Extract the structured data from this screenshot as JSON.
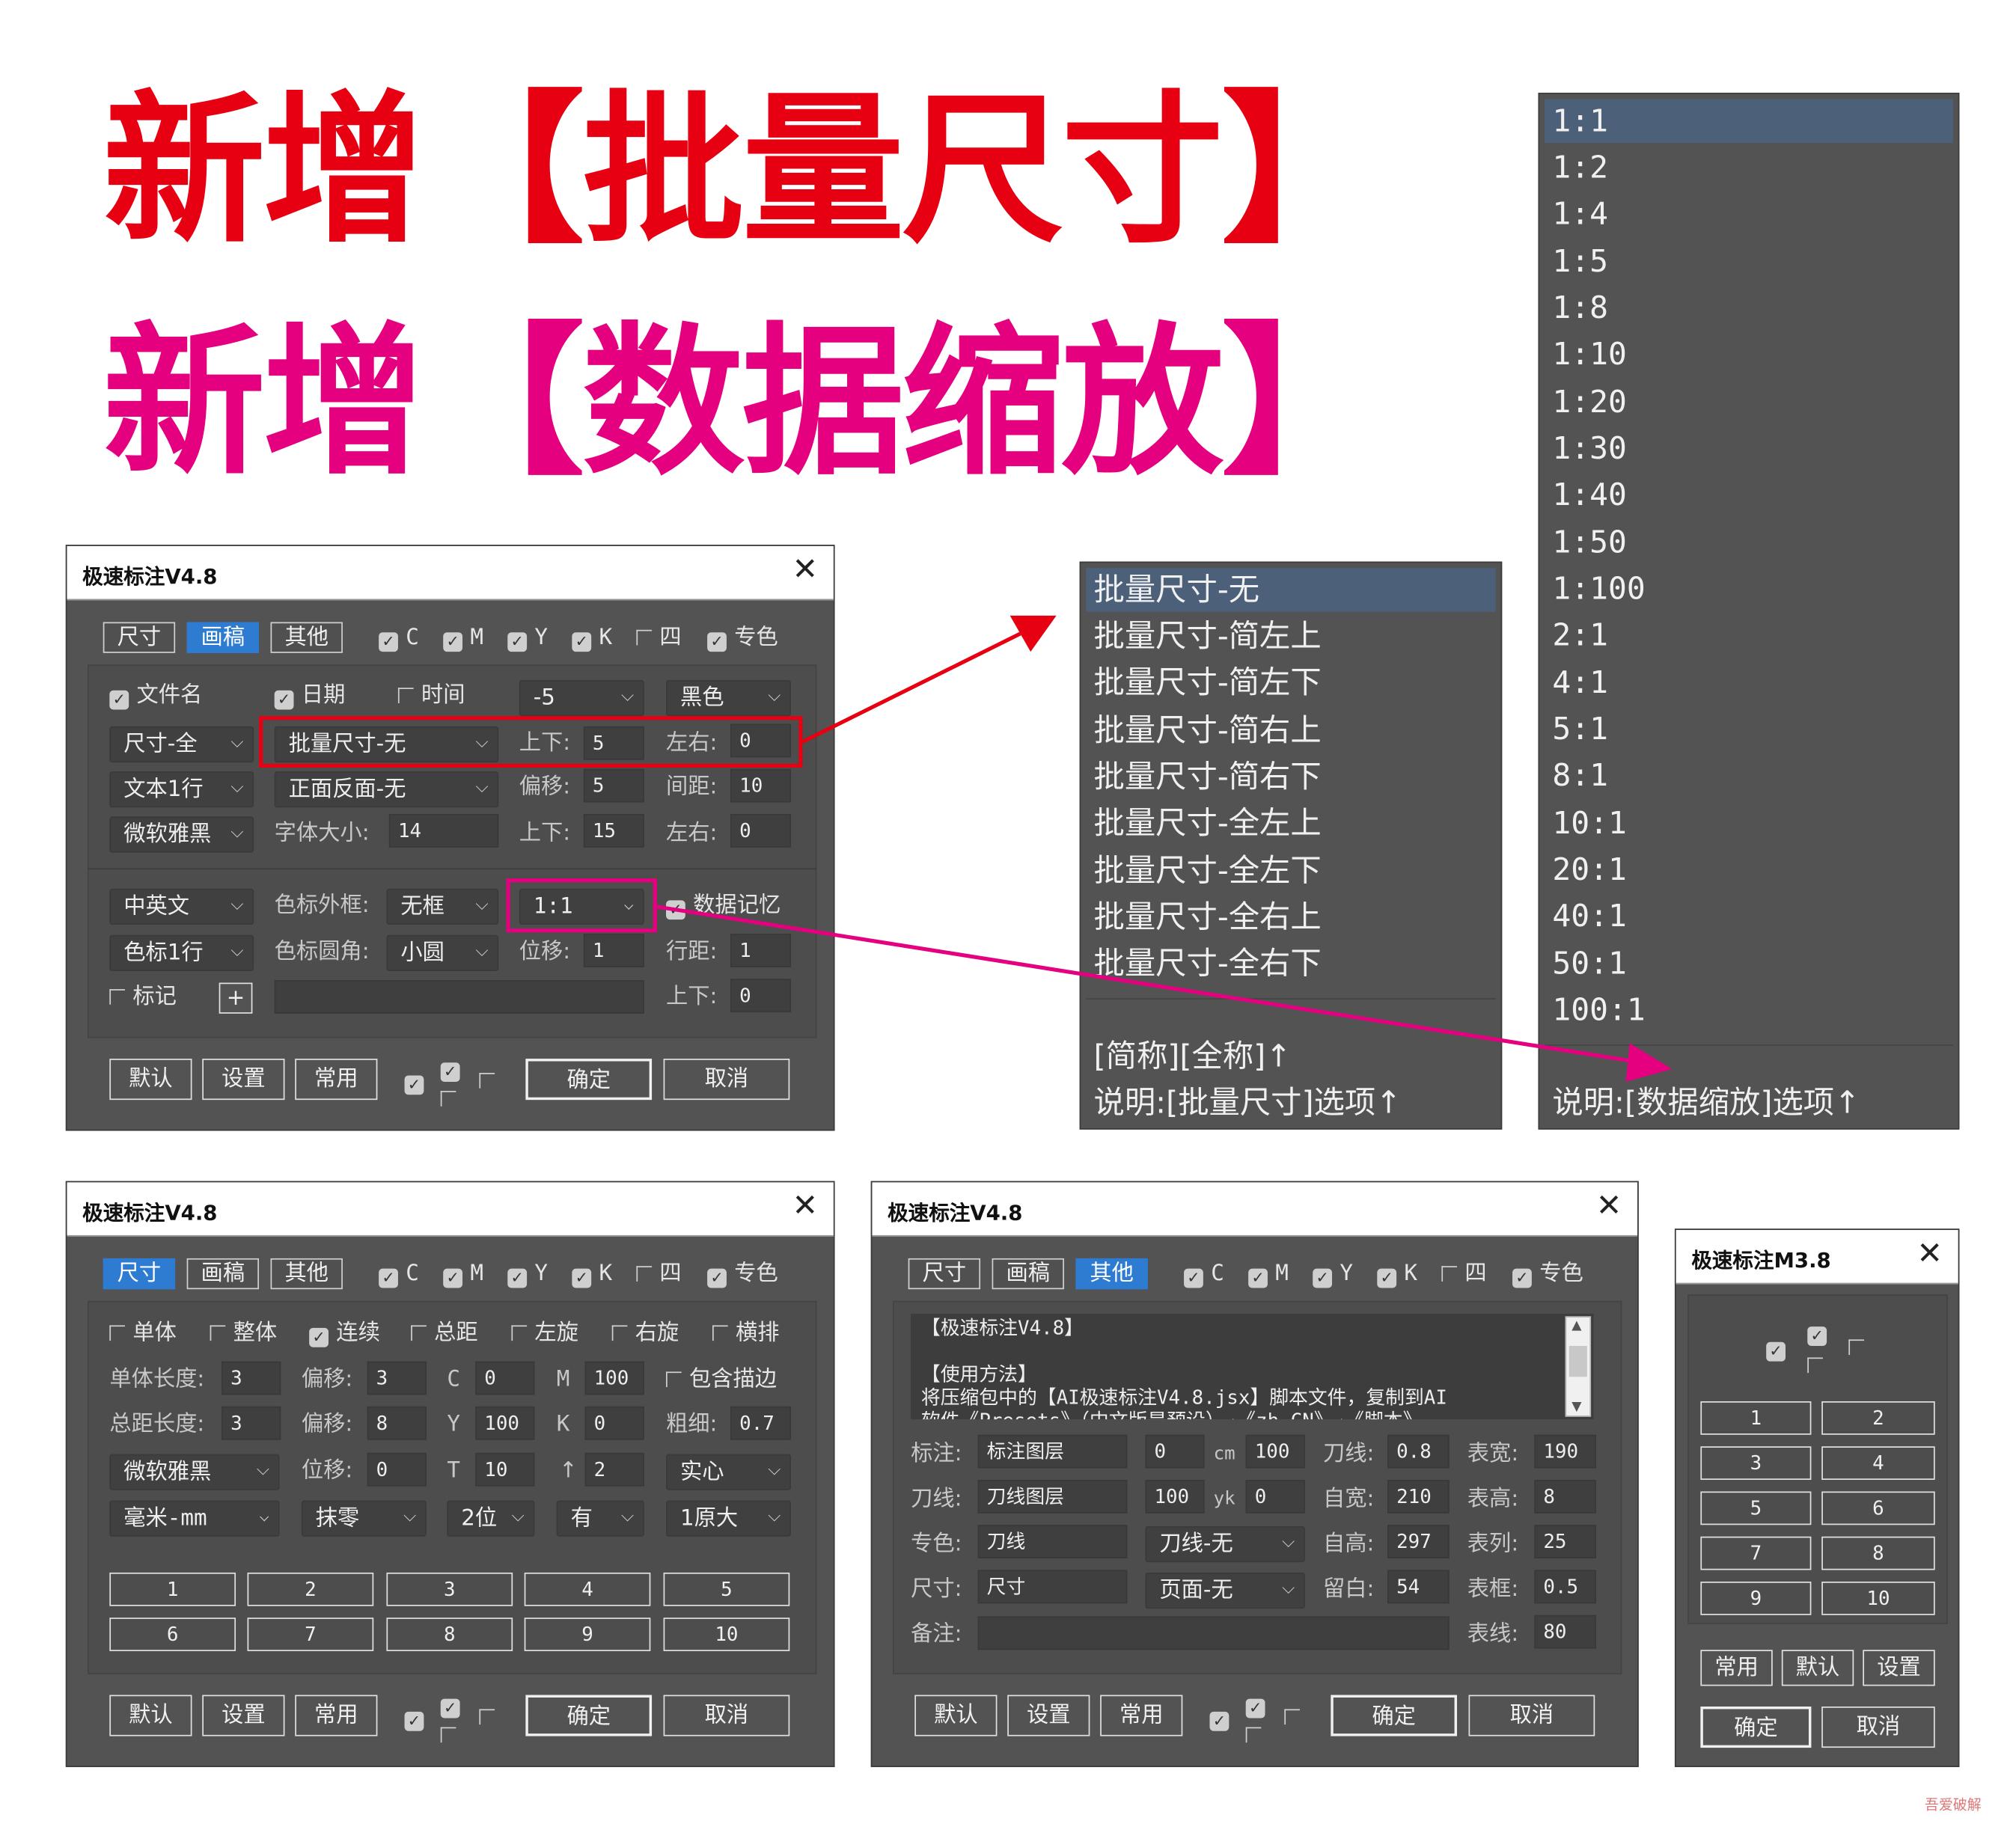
{
  "headline": {
    "line1": "新增【批量尺寸】",
    "line2": "新增【数据缩放】",
    "color1": "#e60012",
    "color2": "#e4007f"
  },
  "win1": {
    "title": "极速标注V4.8",
    "close": "✕",
    "tabs": [
      "尺寸",
      "画稿",
      "其他"
    ],
    "active_tab": 1,
    "color_checks": [
      {
        "label": "C",
        "checked": true
      },
      {
        "label": "M",
        "checked": true
      },
      {
        "label": "Y",
        "checked": true
      },
      {
        "label": "K",
        "checked": true
      },
      {
        "label": "四",
        "checked": false
      },
      {
        "label": "专色",
        "checked": true
      }
    ],
    "filename": "文件名",
    "date": "日期",
    "time": "时间",
    "offset_dd": "-5",
    "color_dd": "黑色",
    "size_dd": "尺寸-全",
    "batch_dd": "批量尺寸-无",
    "ud_label": "上下:",
    "ud_val": "5",
    "lr_label": "左右:",
    "lr_val": "0",
    "text_dd": "文本1行",
    "face_dd": "正面反面-无",
    "shift_label": "偏移:",
    "shift_val": "5",
    "gap_label": "间距:",
    "gap_val": "10",
    "font_dd": "微软雅黑",
    "fontsize_label": "字体大小:",
    "fontsize_val": "14",
    "ud2_label": "上下:",
    "ud2_val": "15",
    "lr2_label": "左右:",
    "lr2_val": "0",
    "lang_dd": "中英文",
    "frame_label": "色标外框:",
    "frame_dd": "无框",
    "scale_dd": "1:1",
    "memory": "数据记忆",
    "row_dd": "色标1行",
    "corner_label": "色标圆角:",
    "corner_dd": "小圆",
    "shift2_label": "位移:",
    "shift2_val": "1",
    "lh_label": "行距:",
    "lh_val": "1",
    "mark": "标记",
    "plus": "+",
    "ud3_label": "上下:",
    "ud3_val": "0",
    "buttons": {
      "default": "默认",
      "settings": "设置",
      "common": "常用",
      "ok": "确定",
      "cancel": "取消"
    }
  },
  "batch_list": {
    "items": [
      "批量尺寸-无",
      "批量尺寸-简左上",
      "批量尺寸-简左下",
      "批量尺寸-简右上",
      "批量尺寸-简右下",
      "批量尺寸-全左上",
      "批量尺寸-全左下",
      "批量尺寸-全右上",
      "批量尺寸-全右下"
    ],
    "selected": 0,
    "footer1": "[简称][全称]↑",
    "footer2": "说明:[批量尺寸]选项↑"
  },
  "scale_list": {
    "items": [
      "1:1",
      "1:2",
      "1:4",
      "1:5",
      "1:8",
      "1:10",
      "1:20",
      "1:30",
      "1:40",
      "1:50",
      "1:100",
      "2:1",
      "4:1",
      "5:1",
      "8:1",
      "10:1",
      "20:1",
      "40:1",
      "50:1",
      "100:1"
    ],
    "selected": 0,
    "footer": "说明:[数据缩放]选项↑"
  },
  "win2": {
    "title": "极速标注V4.8",
    "close": "✕",
    "tabs": [
      "尺寸",
      "画稿",
      "其他"
    ],
    "active_tab": 0,
    "color_checks": [
      {
        "label": "C",
        "checked": true
      },
      {
        "label": "M",
        "checked": true
      },
      {
        "label": "Y",
        "checked": true
      },
      {
        "label": "K",
        "checked": true
      },
      {
        "label": "四",
        "checked": false
      },
      {
        "label": "专色",
        "checked": true
      }
    ],
    "modes": [
      {
        "label": "单体",
        "checked": false
      },
      {
        "label": "整体",
        "checked": false
      },
      {
        "label": "连续",
        "checked": true
      },
      {
        "label": "总距",
        "checked": false
      },
      {
        "label": "左旋",
        "checked": false
      },
      {
        "label": "右旋",
        "checked": false
      },
      {
        "label": "横排",
        "checked": false
      }
    ],
    "single_len_label": "单体长度:",
    "single_len": "3",
    "shift_label": "偏移:",
    "shift_val": "3",
    "c_label": "C",
    "c_val": "0",
    "m_label": "M",
    "m_val": "100",
    "stroke": "包含描边",
    "total_len_label": "总距长度:",
    "total_len": "3",
    "shift2_label": "偏移:",
    "shift2_val": "8",
    "y_label": "Y",
    "y_val": "100",
    "k_label": "K",
    "k_val": "0",
    "thick_label": "粗细:",
    "thick_val": "0.7",
    "font_dd": "微软雅黑",
    "move_label": "位移:",
    "move_val": "0",
    "t_label": "T",
    "t_val": "10",
    "arrow_label": "↑",
    "arrow_val": "2",
    "solid_dd": "实心",
    "unit_dd": "毫米-mm",
    "zero_dd": "抹零",
    "digits_dd": "2位",
    "has_dd": "有",
    "orig_dd": "1原大",
    "numbers": [
      "1",
      "2",
      "3",
      "4",
      "5",
      "6",
      "7",
      "8",
      "9",
      "10"
    ],
    "buttons": {
      "default": "默认",
      "settings": "设置",
      "common": "常用",
      "ok": "确定",
      "cancel": "取消"
    }
  },
  "win3": {
    "title": "极速标注V4.8",
    "close": "✕",
    "tabs": [
      "尺寸",
      "画稿",
      "其他"
    ],
    "active_tab": 2,
    "color_checks": [
      {
        "label": "C",
        "checked": true
      },
      {
        "label": "M",
        "checked": true
      },
      {
        "label": "Y",
        "checked": true
      },
      {
        "label": "K",
        "checked": true
      },
      {
        "label": "四",
        "checked": false
      },
      {
        "label": "专色",
        "checked": true
      }
    ],
    "text_lines": [
      "【极速标注V4.8】",
      "",
      "【使用方法】",
      "将压缩包中的【AI极速标注V4.8.jsx】脚本文件，复制到AI",
      "软件《Presets》（中文版是预设）→《zh_CN》→《脚本》"
    ],
    "mark_label": "标注:",
    "mark_val": "标注图层",
    "v0": "0",
    "cm": "cm",
    "v100": "100",
    "knife_label": "刀线:",
    "knife_val": "0.8",
    "tw_label": "表宽:",
    "tw_val": "190",
    "kl_label": "刀线:",
    "kl_val": "刀线图层",
    "v100b": "100",
    "yk": "yk",
    "v0b": "0",
    "selfw_label": "自宽:",
    "selfw_val": "210",
    "th_label": "表高:",
    "th_val": "8",
    "spot_label": "专色:",
    "spot_val": "刀线",
    "knife_dd": "刀线-无",
    "selfh_label": "自高:",
    "selfh_val": "297",
    "tc_label": "表列:",
    "tc_val": "25",
    "size_label": "尺寸:",
    "size_val": "尺寸",
    "page_dd": "页面-无",
    "margin_label": "留白:",
    "margin_val": "54",
    "tf_label": "表框:",
    "tf_val": "0.5",
    "note_label": "备注:",
    "tl_label": "表线:",
    "tl_val": "80",
    "buttons": {
      "default": "默认",
      "settings": "设置",
      "common": "常用",
      "ok": "确定",
      "cancel": "取消"
    }
  },
  "win4": {
    "title": "极速标注M3.8",
    "close": "✕",
    "numbers": [
      "1",
      "2",
      "3",
      "4",
      "5",
      "6",
      "7",
      "8",
      "9",
      "10"
    ],
    "buttons": {
      "common": "常用",
      "default": "默认",
      "settings": "设置",
      "ok": "确定",
      "cancel": "取消"
    }
  },
  "watermark": "吾爱破解"
}
